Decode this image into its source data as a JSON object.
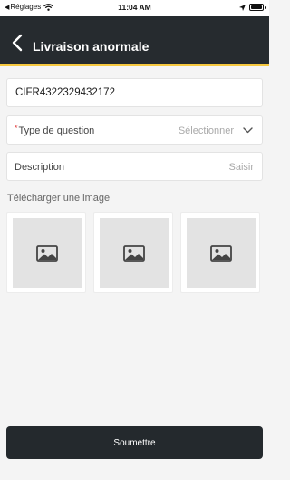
{
  "status_bar": {
    "back_app": "Réglages",
    "time": "11:04 AM"
  },
  "header": {
    "title": "Livraison anormale"
  },
  "form": {
    "tracking_number": "CIFR4322329432172",
    "question_type": {
      "label": "Type de question",
      "placeholder": "Sélectionner"
    },
    "description": {
      "label": "Description",
      "placeholder": "Saisir"
    },
    "upload": {
      "label": "Télécharger une image",
      "slots": [
        "image-icon",
        "image-icon",
        "image-icon"
      ]
    },
    "submit_label": "Soumettre"
  },
  "colors": {
    "header_bg": "#262b2f",
    "header_accent": "#f6c83f",
    "required_marker": "#e23a3a",
    "button_bg": "#24292d"
  }
}
